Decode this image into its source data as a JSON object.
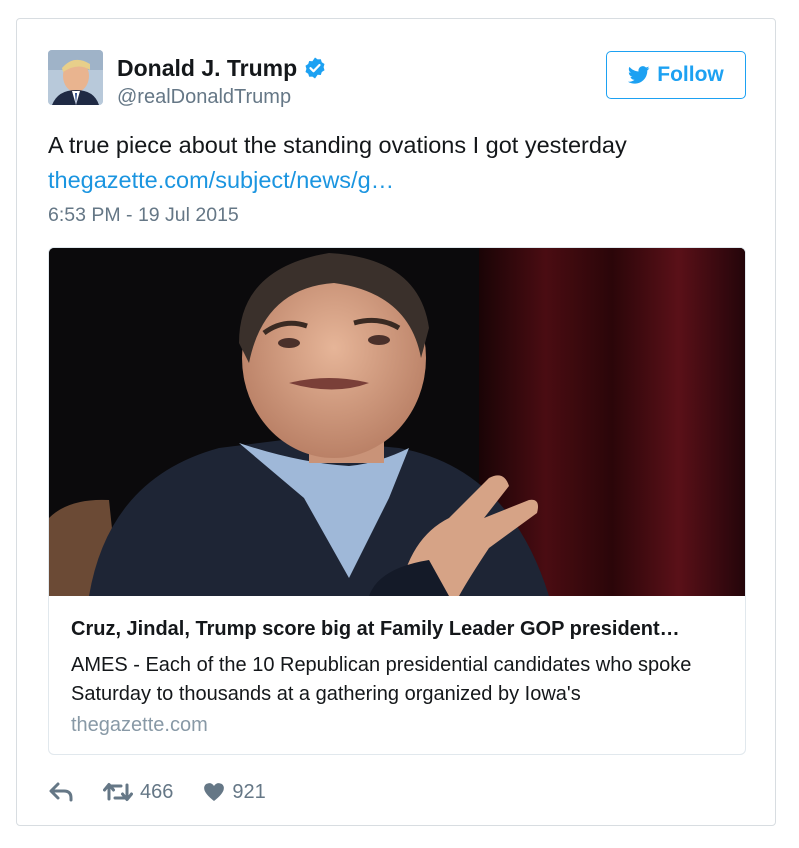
{
  "author": {
    "name": "Donald J. Trump",
    "handle": "@realDonaldTrump",
    "verified": true,
    "avatar_icon": "profile-photo"
  },
  "follow_button": {
    "label": "Follow",
    "icon": "twitter-bird-icon"
  },
  "tweet": {
    "text": "A true piece about the standing ovations I got yesterday",
    "link_text": "thegazette.com/subject/news/g…",
    "timestamp": "6:53 PM - 19 Jul 2015"
  },
  "card": {
    "image_icon": "news-photo",
    "title": "Cruz, Jindal, Trump score big at Family Leader GOP president…",
    "description": "AMES - Each of the 10 Republican presidential candidates who spoke Saturday to thousands at a gathering organized by Iowa's",
    "domain": "thegazette.com"
  },
  "actions": {
    "reply_icon": "reply-icon",
    "retweet_icon": "retweet-icon",
    "retweet_count": "466",
    "like_icon": "heart-icon",
    "like_count": "921"
  },
  "colors": {
    "accent": "#1da1f2",
    "link": "#1b95e0",
    "muted": "#657786",
    "border": "#d8dde1"
  }
}
